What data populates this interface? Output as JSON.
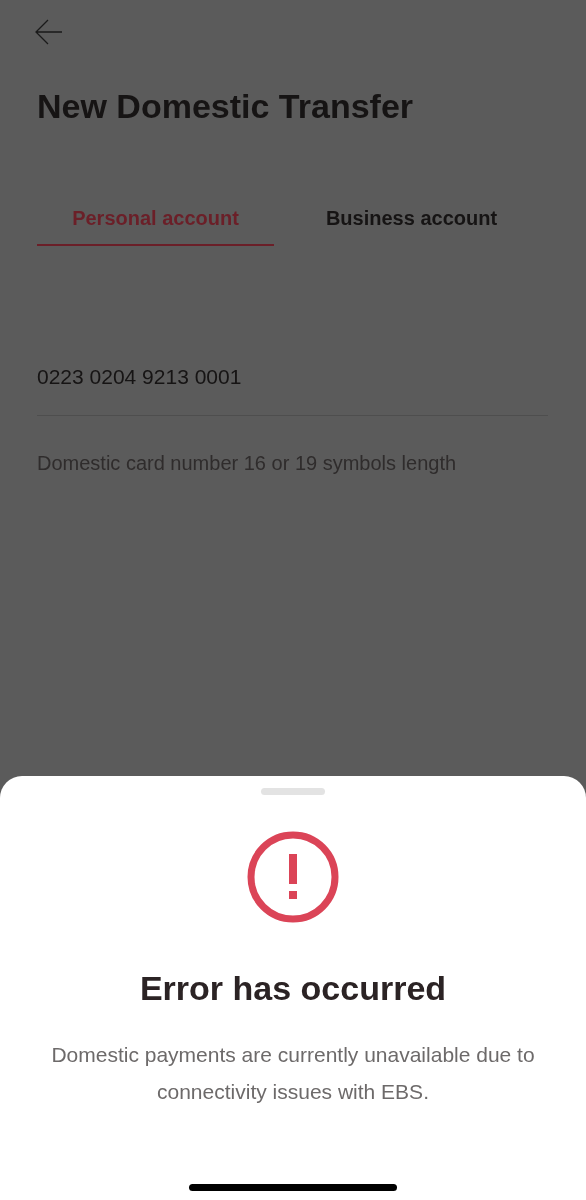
{
  "header": {
    "title": "New Domestic Transfer"
  },
  "tabs": [
    {
      "label": "Personal account",
      "selected": true
    },
    {
      "label": "Business account",
      "selected": false
    }
  ],
  "card_field": {
    "value": "0223 0204 9213 0001",
    "hint": "Domestic card number 16 or 19 symbols length"
  },
  "error_sheet": {
    "title": "Error has occurred",
    "message": "Domestic payments are currently unavailable due to connectivity issues with EBS."
  }
}
